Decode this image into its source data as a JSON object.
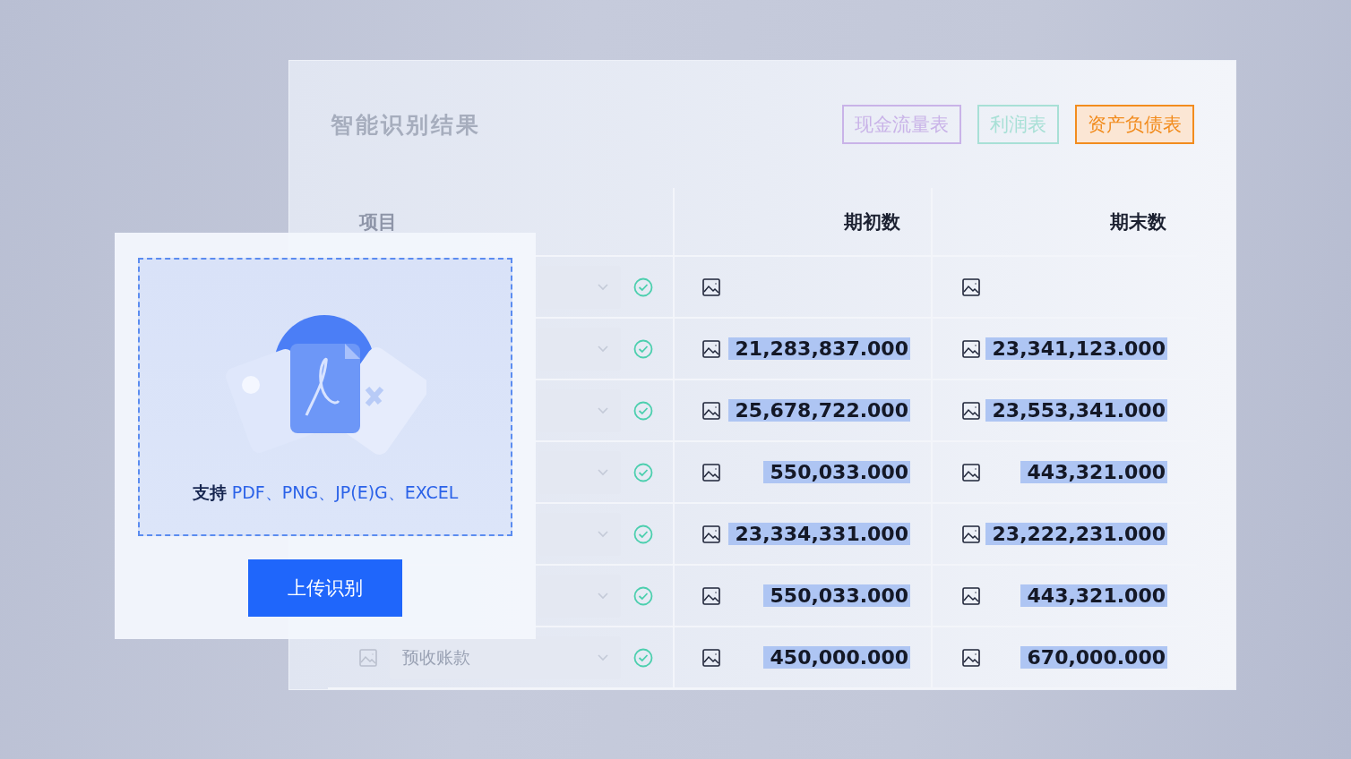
{
  "panel": {
    "title": "智能识别结果",
    "tabs": [
      {
        "label": "现金流量表",
        "selected": false,
        "color": "#c9b3e8"
      },
      {
        "label": "利润表",
        "selected": false,
        "color": "#a8e0d6"
      },
      {
        "label": "资产负债表",
        "selected": true,
        "color": "#f28c1e"
      }
    ]
  },
  "table": {
    "columns": [
      "项目",
      "期初数",
      "期末数"
    ],
    "rows": [
      {
        "verified": true,
        "start": {},
        "end": {}
      },
      {
        "verified": true,
        "start": {
          "value": "21,283,837.000",
          "highlighted": true
        },
        "end": {
          "value": "23,341,123.000",
          "highlighted": true
        }
      },
      {
        "verified": true,
        "start": {
          "value": "25,678,722.000",
          "highlighted": true
        },
        "end": {
          "value": "23,553,341.000",
          "highlighted": true
        }
      },
      {
        "verified": true,
        "start": {
          "value": "550,033.000",
          "highlighted": true
        },
        "end": {
          "value": "443,321.000",
          "highlighted": true
        }
      },
      {
        "verified": true,
        "start": {
          "value": "23,334,331.000",
          "highlighted": true
        },
        "end": {
          "value": "23,222,231.000",
          "highlighted": true
        }
      },
      {
        "verified": true,
        "start": {
          "value": "550,033.000",
          "highlighted": true
        },
        "end": {
          "value": "443,321.000",
          "highlighted": true
        }
      },
      {
        "verified": true,
        "item": "预收账款",
        "start": {
          "value": "450,000.000",
          "highlighted": true
        },
        "end": {
          "value": "670,000.000",
          "highlighted": true
        }
      }
    ]
  },
  "upload": {
    "formats": "**支持** PDF、PNG、JP(E)G、EXCEL",
    "button": "上传识别"
  }
}
